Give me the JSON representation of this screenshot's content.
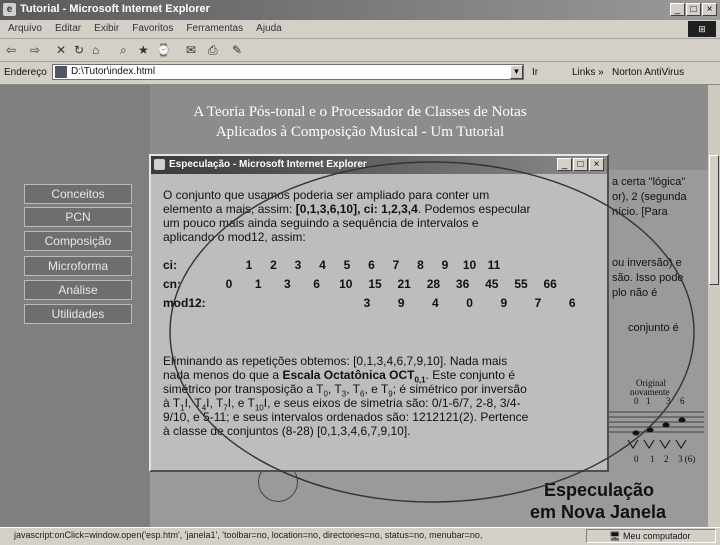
{
  "window": {
    "title": "Tutorial - Microsoft Internet Explorer",
    "min": "_",
    "max": "□",
    "close": "×"
  },
  "menu": [
    "Arquivo",
    "Editar",
    "Exibir",
    "Favoritos",
    "Ferramentas",
    "Ajuda"
  ],
  "toolbar_glyphs": [
    "⇦",
    "⇨",
    "✕",
    "↻",
    "⌂",
    "⌕",
    "★",
    "⌚",
    "✉",
    "⎙",
    "✎"
  ],
  "address": {
    "label": "Endereço",
    "url": "D:\\Tutor\\index.html",
    "go": "Ir",
    "links": "Links »",
    "norton": "Norton AntiVirus"
  },
  "page": {
    "heading_line1": "A Teoria Pós-tonal e o Processador de Classes de Notas",
    "heading_line2": "Aplicados à Composição Musical - Um Tutorial",
    "nav": [
      "Conceitos",
      "PCN",
      "Composição",
      "Microforma",
      "Análise",
      "Utilidades"
    ],
    "right_snippets": [
      "a certa \"lógica\"",
      "or), 2 (segunda",
      "nício. [Para",
      "ou inversão) e",
      "são. Isso pode",
      "plo não é",
      "conjunto é"
    ],
    "music": {
      "title1": "Original",
      "title2": "novamente",
      "top_numbers": [
        "0",
        "1",
        "3",
        "6"
      ],
      "bottom_numbers": [
        "0",
        "1",
        "2",
        "3 (6)"
      ]
    },
    "special_line1": "Especulação",
    "special_line2": "em Nova Janela"
  },
  "popup": {
    "title": "Especulação - Microsoft Internet Explorer",
    "para1": [
      "O conjunto que usamos poderia ser ampliado para conter um",
      "elemento a mais, assim:",
      "[0,1,3,6,10], ci: 1,2,3,4",
      ". Podemos especular",
      "um pouco mais ainda seguindo a sequência de intervalos e",
      "aplicando o mod12, assim:"
    ],
    "table": {
      "ci_label": "ci:",
      "cn_label": "cn:",
      "mod_label": "mod12:",
      "ci": [
        "1",
        "2",
        "3",
        "4",
        "5",
        "6",
        "7",
        "8",
        "9",
        "10",
        "11"
      ],
      "cn": [
        "0",
        "1",
        "3",
        "6",
        "10",
        "15",
        "21",
        "28",
        "36",
        "45",
        "55",
        "66"
      ],
      "mod12": [
        "3",
        "9",
        "4",
        "0",
        "9",
        "7",
        "6"
      ]
    },
    "para2": {
      "l1": "Eliminando as repetições obtemos: [0,1,3,4,6,7,9,10]. Nada mais",
      "l2a": "nada menos do que a",
      "l2b": "Escala Octatônica OCT",
      "l2sub": "0,1",
      "l2c": ". Este conjunto é",
      "l3": "simétrico por transposição a T",
      "l4": "à T",
      "l5": "9/10, e 5-11; e seus intervalos ordenados são: 1212121(2). Pertence",
      "l6": "à classe de conjuntos (8-28) [0,1,3,4,6,7,9,10]."
    }
  },
  "status": {
    "text": "javascript:onClick=window.open('esp.htm', 'janela1', 'toolbar=no, location=no, directories=no, status=no, menubar=no,",
    "zone": "Meu computador"
  }
}
